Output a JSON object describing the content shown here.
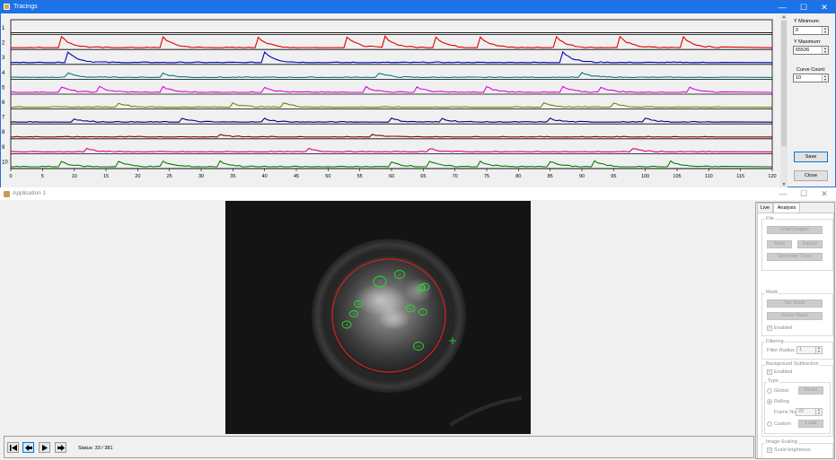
{
  "tracings_window": {
    "title": "Tracings",
    "icon": "app-icon",
    "controls": {
      "minimize": "—",
      "maximize": "☐",
      "close": "✕"
    },
    "row_labels": [
      "1",
      "2",
      "3",
      "4",
      "5",
      "6",
      "7",
      "8",
      "9",
      "10"
    ],
    "x_axis_ticks": [
      "0",
      "5",
      "10",
      "15",
      "20",
      "25",
      "30",
      "35",
      "40",
      "45",
      "50",
      "55",
      "60",
      "65",
      "70",
      "75",
      "80",
      "85",
      "90",
      "95",
      "100",
      "105",
      "110",
      "115",
      "120"
    ],
    "x_range": [
      0,
      120
    ],
    "data_end_frame": 112,
    "trace_colors": [
      "#000000",
      "#e00000",
      "#0000c0",
      "#008080",
      "#e000e0",
      "#808000",
      "#000080",
      "#800000",
      "#e0007f",
      "#008000"
    ],
    "y_minimum_label": "Y Minimum:",
    "y_minimum_value": "0",
    "y_maximum_label": "Y Maximum:",
    "y_maximum_value": "65536",
    "curve_count_label": "Curve Count:",
    "curve_count_value": "10",
    "save_button": "Save",
    "close_button": "Close"
  },
  "app_window": {
    "title": "Application 1",
    "icon": "app-icon",
    "controls": {
      "minimize": "—",
      "maximize": "☐",
      "close": "✕"
    },
    "roi_labels": [
      "1",
      "2",
      "3",
      "4",
      "5",
      "6",
      "7",
      "8",
      "9",
      "10"
    ],
    "status": "Status: 33 / 381",
    "nav": [
      "first-frame",
      "previous-frame",
      "play",
      "next-frame"
    ]
  },
  "side_panel": {
    "tabs": [
      "Live",
      "Analysis"
    ],
    "active_tab": "Analysis",
    "file_group": "File",
    "load_images": "Load Images",
    "save": "Save",
    "export": "Export",
    "generate_trace": "Generate Trace",
    "mask_group": "Mask",
    "set_mask": "Set Mask",
    "reset_mask": "Reset Mask",
    "mask_enabled": "Enabled",
    "filtering_group": "Filtering",
    "filter_radius_label": "Filter Radius",
    "filter_radius_value": "1",
    "bg_sub_group": "Background Subtraction",
    "bg_enabled": "Enabled",
    "type_group": "Type",
    "global": "Global",
    "reset": "Reset",
    "rolling": "Rolling",
    "frame_no_label": "Frame No",
    "frame_no_value": "20",
    "custom": "Custom",
    "load": "Load",
    "image_scaling_group": "Image Scaling",
    "scale_brightness": "Scale brightness"
  }
}
